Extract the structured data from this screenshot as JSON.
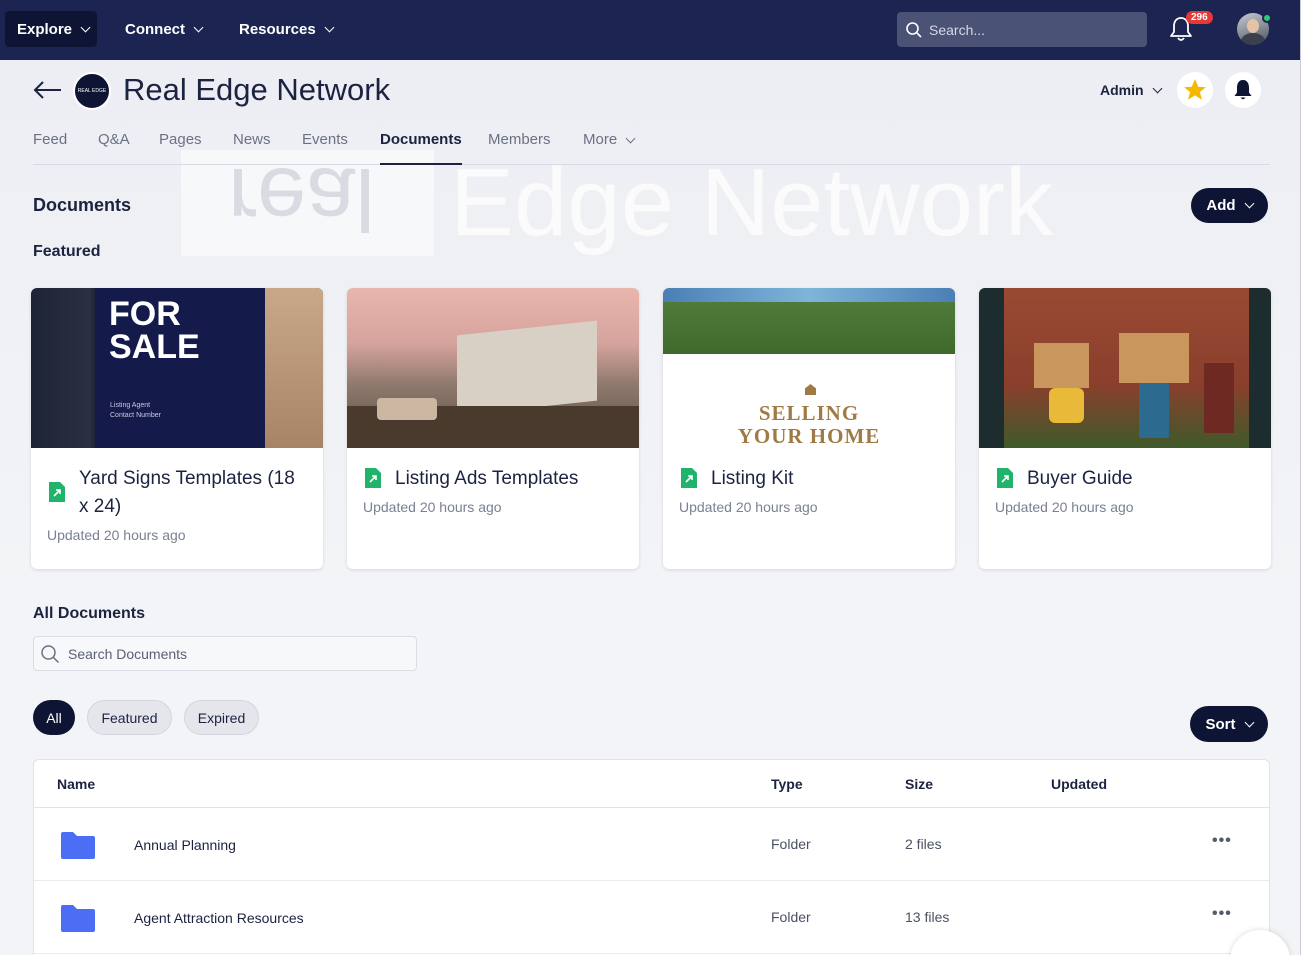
{
  "topnav": {
    "explore_label": "Explore",
    "connect_label": "Connect",
    "resources_label": "Resources",
    "search_placeholder": "Search...",
    "notification_count": "296"
  },
  "group": {
    "title": "Real Edge Network",
    "logo_text": "REAL EDGE",
    "admin_label": "Admin",
    "watermark_left": "real",
    "watermark_right": "Edge Network"
  },
  "tabs": [
    {
      "label": "Feed"
    },
    {
      "label": "Q&A"
    },
    {
      "label": "Pages"
    },
    {
      "label": "News"
    },
    {
      "label": "Events"
    },
    {
      "label": "Documents"
    },
    {
      "label": "Members"
    },
    {
      "label": "More"
    }
  ],
  "documents": {
    "title": "Documents",
    "add_label": "Add",
    "featured_title": "Featured",
    "all_title": "All Documents",
    "search_placeholder": "Search Documents",
    "filters": [
      "All",
      "Featured",
      "Expired"
    ],
    "sort_label": "Sort"
  },
  "featured_cards": [
    {
      "title": "Yard Signs Templates (18 x 24)",
      "updated": "Updated 20 hours ago",
      "img_line1": "FOR",
      "img_line2": "SALE",
      "img_small1": "Listing Agent",
      "img_small2": "Contact Number"
    },
    {
      "title": "Listing Ads Templates",
      "updated": "Updated 20 hours ago"
    },
    {
      "title": "Listing Kit",
      "updated": "Updated 20 hours ago",
      "img_line1": "SELLING",
      "img_line2": "YOUR HOME"
    },
    {
      "title": "Buyer Guide",
      "updated": "Updated 20 hours ago"
    }
  ],
  "table": {
    "headers": {
      "name": "Name",
      "type": "Type",
      "size": "Size",
      "updated": "Updated"
    },
    "rows": [
      {
        "name": "Annual Planning",
        "type": "Folder",
        "size": "2 files",
        "updated": "",
        "more": "•••"
      },
      {
        "name": "Agent Attraction Resources",
        "type": "Folder",
        "size": "13 files",
        "updated": "",
        "more": "•••"
      }
    ]
  },
  "colors": {
    "nav_bg": "#1c2552",
    "primary_dark": "#0e1433",
    "badge_red": "#e53935",
    "doc_icon_green": "#1fb36b",
    "folder_blue": "#4c6ef5",
    "star_yellow": "#f5b800"
  }
}
